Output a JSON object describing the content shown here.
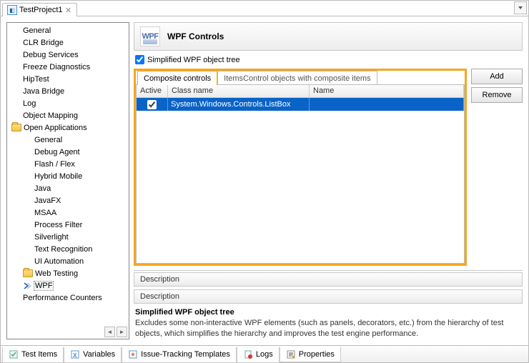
{
  "tabbar": {
    "project_tab": "TestProject1"
  },
  "sidebar": {
    "items": [
      {
        "label": "General",
        "indent": 1
      },
      {
        "label": "CLR Bridge",
        "indent": 1
      },
      {
        "label": "Debug Services",
        "indent": 1
      },
      {
        "label": "Freeze Diagnostics",
        "indent": 1
      },
      {
        "label": "HipTest",
        "indent": 1
      },
      {
        "label": "Java Bridge",
        "indent": 1
      },
      {
        "label": "Log",
        "indent": 1
      },
      {
        "label": "Object Mapping",
        "indent": 1
      },
      {
        "label": "Open Applications",
        "indent": 0,
        "folder": true
      },
      {
        "label": "General",
        "indent": 2
      },
      {
        "label": "Debug Agent",
        "indent": 2
      },
      {
        "label": "Flash / Flex",
        "indent": 2
      },
      {
        "label": "Hybrid Mobile",
        "indent": 2
      },
      {
        "label": "Java",
        "indent": 2
      },
      {
        "label": "JavaFX",
        "indent": 2
      },
      {
        "label": "MSAA",
        "indent": 2
      },
      {
        "label": "Process Filter",
        "indent": 2
      },
      {
        "label": "Silverlight",
        "indent": 2
      },
      {
        "label": "Text Recognition",
        "indent": 2
      },
      {
        "label": "UI Automation",
        "indent": 2
      },
      {
        "label": "Web Testing",
        "indent": 1,
        "folder": true
      },
      {
        "label": "WPF",
        "indent": 2,
        "selected": true,
        "arrow": true
      },
      {
        "label": "Performance Counters",
        "indent": 1
      }
    ]
  },
  "header": {
    "logo_text": "WPF",
    "title": "WPF Controls"
  },
  "option": {
    "simplified_label": "Simplified WPF object tree",
    "checked": true
  },
  "inner_tabs": {
    "composite": "Composite controls",
    "itemscontrol": "ItemsControl objects with composite items"
  },
  "grid": {
    "cols": {
      "active": "Active",
      "classname": "Class name",
      "name": "Name"
    },
    "rows": [
      {
        "active": true,
        "classname": "System.Windows.Controls.ListBox",
        "name": ""
      }
    ]
  },
  "buttons": {
    "add": "Add",
    "remove": "Remove"
  },
  "description": {
    "label": "Description",
    "label2": "Description",
    "title": "Simplified WPF object tree",
    "text": "Excludes some non-interactive WPF elements (such as panels, decorators, etc.) from the hierarchy of test objects, which simplifies the hierarchy and improves the test engine performance."
  },
  "bottom_tabs": {
    "test_items": "Test Items",
    "variables": "Variables",
    "issue_tracking": "Issue-Tracking Templates",
    "logs": "Logs",
    "properties": "Properties"
  }
}
